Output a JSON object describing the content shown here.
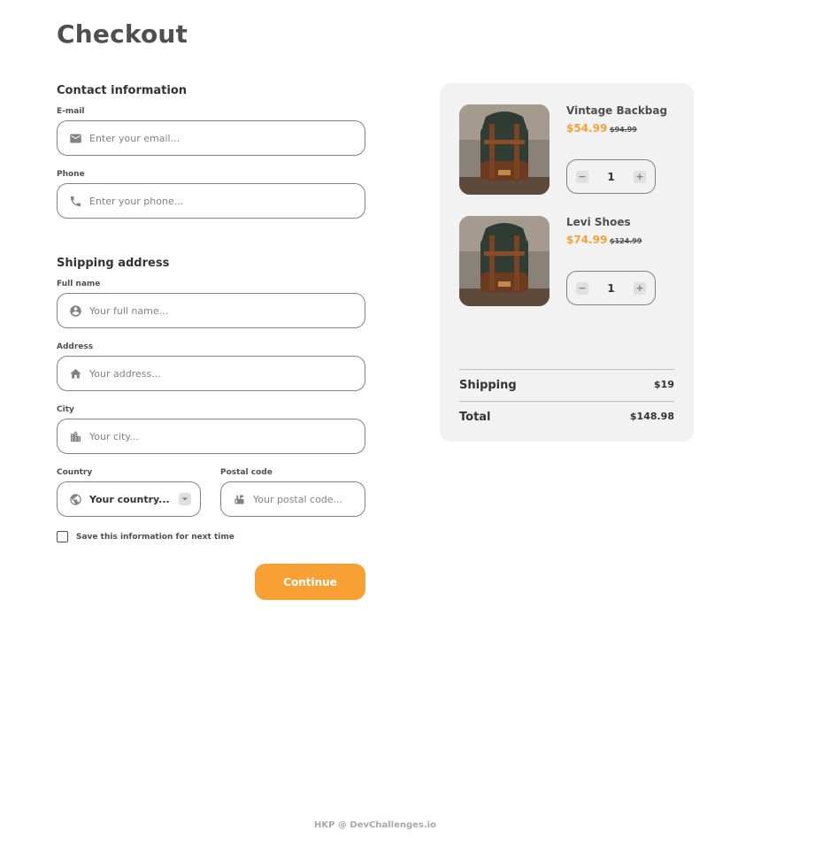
{
  "page": {
    "title": "Checkout"
  },
  "contact": {
    "title": "Contact information",
    "email": {
      "label": "E-mail",
      "placeholder": "Enter your email...",
      "icon": "mail-icon"
    },
    "phone": {
      "label": "Phone",
      "placeholder": "Enter your phone...",
      "icon": "phone-icon"
    }
  },
  "shipping": {
    "title": "Shipping address",
    "full_name": {
      "label": "Full name",
      "placeholder": "Your full name...",
      "icon": "user-circle-icon"
    },
    "address": {
      "label": "Address",
      "placeholder": "Your address...",
      "icon": "home-icon"
    },
    "city": {
      "label": "City",
      "placeholder": "Your city...",
      "icon": "city-icon"
    },
    "country": {
      "label": "Country",
      "value": "Your country...",
      "icon": "globe-icon"
    },
    "postal": {
      "label": "Postal code",
      "placeholder": "Your postal code...",
      "icon": "mailbox-icon"
    }
  },
  "save_info": {
    "label": "Save this information for next time",
    "checked": false
  },
  "continue_label": "Continue",
  "cart": {
    "items": [
      {
        "name": "Vintage Backbag",
        "price": "$54.99",
        "old_price": "$94.99",
        "quantity": "1",
        "minus": "−",
        "plus": "+"
      },
      {
        "name": "Levi Shoes",
        "price": "$74.99",
        "old_price": "$124.99",
        "quantity": "1",
        "minus": "−",
        "plus": "+"
      }
    ],
    "shipping": {
      "label": "Shipping",
      "value": "$19"
    },
    "total": {
      "label": "Total",
      "value": "$148.98"
    }
  },
  "footer": "HKP @ DevChallenges.io",
  "colors": {
    "accent": "#F9A034",
    "border": "#828282",
    "panel": "#F2F2F2"
  }
}
